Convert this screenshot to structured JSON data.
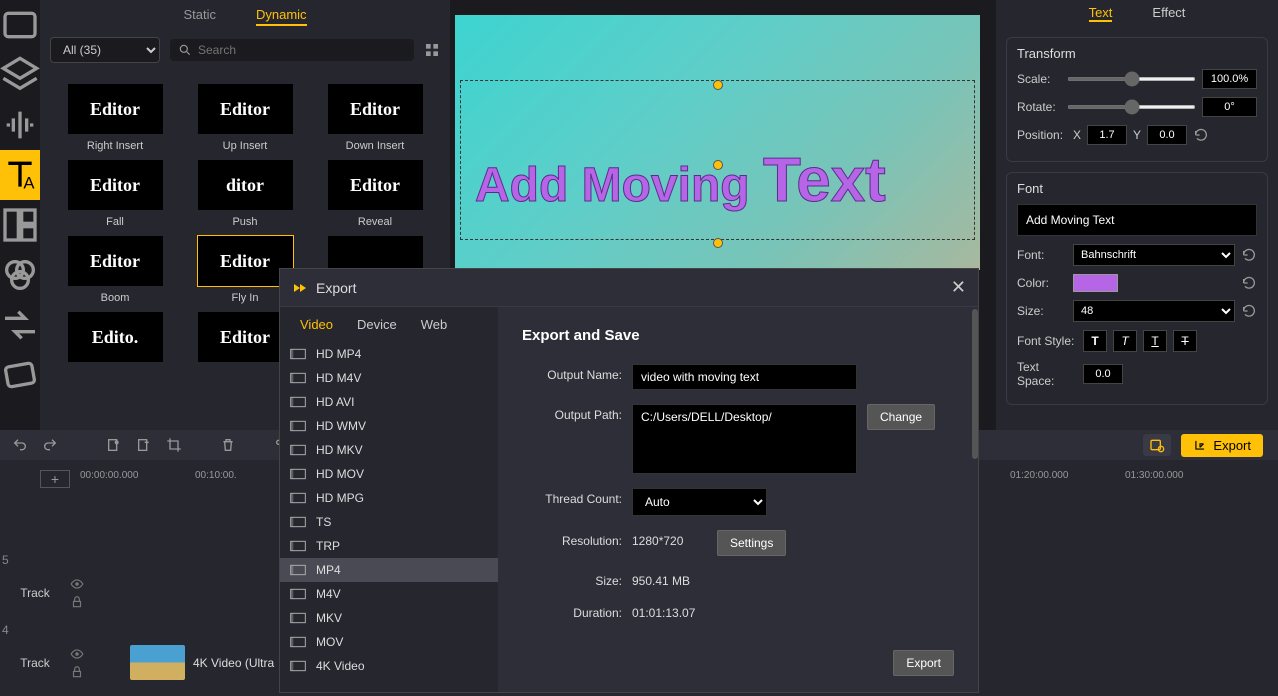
{
  "leftTools": [
    "media",
    "layers",
    "audio",
    "text",
    "templates",
    "filters",
    "transitions",
    "subtitles"
  ],
  "assetPanel": {
    "tabs": [
      "Static",
      "Dynamic"
    ],
    "activeTab": "Dynamic",
    "filter": "All (35)",
    "searchPlaceholder": "Search",
    "items": [
      {
        "thumb": "Editor",
        "label": "Right Insert"
      },
      {
        "thumb": "Editor",
        "label": "Up Insert"
      },
      {
        "thumb": "Editor",
        "label": "Down Insert"
      },
      {
        "thumb": "Editor",
        "label": "Fall"
      },
      {
        "thumb": "ditor",
        "label": "Push"
      },
      {
        "thumb": "Editor",
        "label": "Reveal"
      },
      {
        "thumb": "Editor",
        "label": "Boom"
      },
      {
        "thumb": "Editor",
        "label": "Fly In",
        "selected": true
      },
      {
        "thumb": "",
        "label": ""
      },
      {
        "thumb": "Edito.",
        "label": ""
      },
      {
        "thumb": "Editor",
        "label": ""
      },
      {
        "thumb": "",
        "label": ""
      }
    ]
  },
  "preview": {
    "text1": "Add Moving ",
    "text2": "Text"
  },
  "rightPanel": {
    "tabs": [
      "Text",
      "Effect"
    ],
    "activeTab": "Text",
    "transform": {
      "title": "Transform",
      "scaleLabel": "Scale:",
      "scale": "100.0%",
      "rotateLabel": "Rotate:",
      "rotate": "0°",
      "positionLabel": "Position:",
      "xLabel": "X",
      "x": "1.7",
      "yLabel": "Y",
      "y": "0.0"
    },
    "font": {
      "title": "Font",
      "textValue": "Add Moving Text",
      "fontLabel": "Font:",
      "fontName": "Bahnschrift",
      "colorLabel": "Color:",
      "sizeLabel": "Size:",
      "size": "48",
      "styleLabel": "Font Style:",
      "spaceLabel": "Text Space:",
      "space": "0.0"
    }
  },
  "exportBar": {
    "exportLabel": "Export"
  },
  "timeline": {
    "ticks": [
      "00:00:00.000",
      "00:10:00.",
      "",
      "",
      "01:20:00.000",
      "01:30:00.000"
    ],
    "track1": {
      "num": "5",
      "label": "Track"
    },
    "track2": {
      "num": "4",
      "label": "Track",
      "clipLabel": "4K Video (Ultra "
    }
  },
  "modal": {
    "title": "Export",
    "tabs": [
      "Video",
      "Device",
      "Web"
    ],
    "activeTab": "Video",
    "formats": [
      "HD MP4",
      "HD M4V",
      "HD AVI",
      "HD WMV",
      "HD MKV",
      "HD MOV",
      "HD MPG",
      "TS",
      "TRP",
      "MP4",
      "M4V",
      "MKV",
      "MOV",
      "4K Video"
    ],
    "selectedFormat": "MP4",
    "heading": "Export and Save",
    "outputNameLabel": "Output Name:",
    "outputName": "video with moving text",
    "outputPathLabel": "Output Path:",
    "outputPath": "C:/Users/DELL/Desktop/",
    "changeLabel": "Change",
    "threadLabel": "Thread Count:",
    "threadValue": "Auto",
    "resolutionLabel": "Resolution:",
    "resolution": "1280*720",
    "settingsLabel": "Settings",
    "sizeLabel": "Size:",
    "size": "950.41 MB",
    "durationLabel": "Duration:",
    "duration": "01:01:13.07",
    "exportLabel": "Export"
  }
}
